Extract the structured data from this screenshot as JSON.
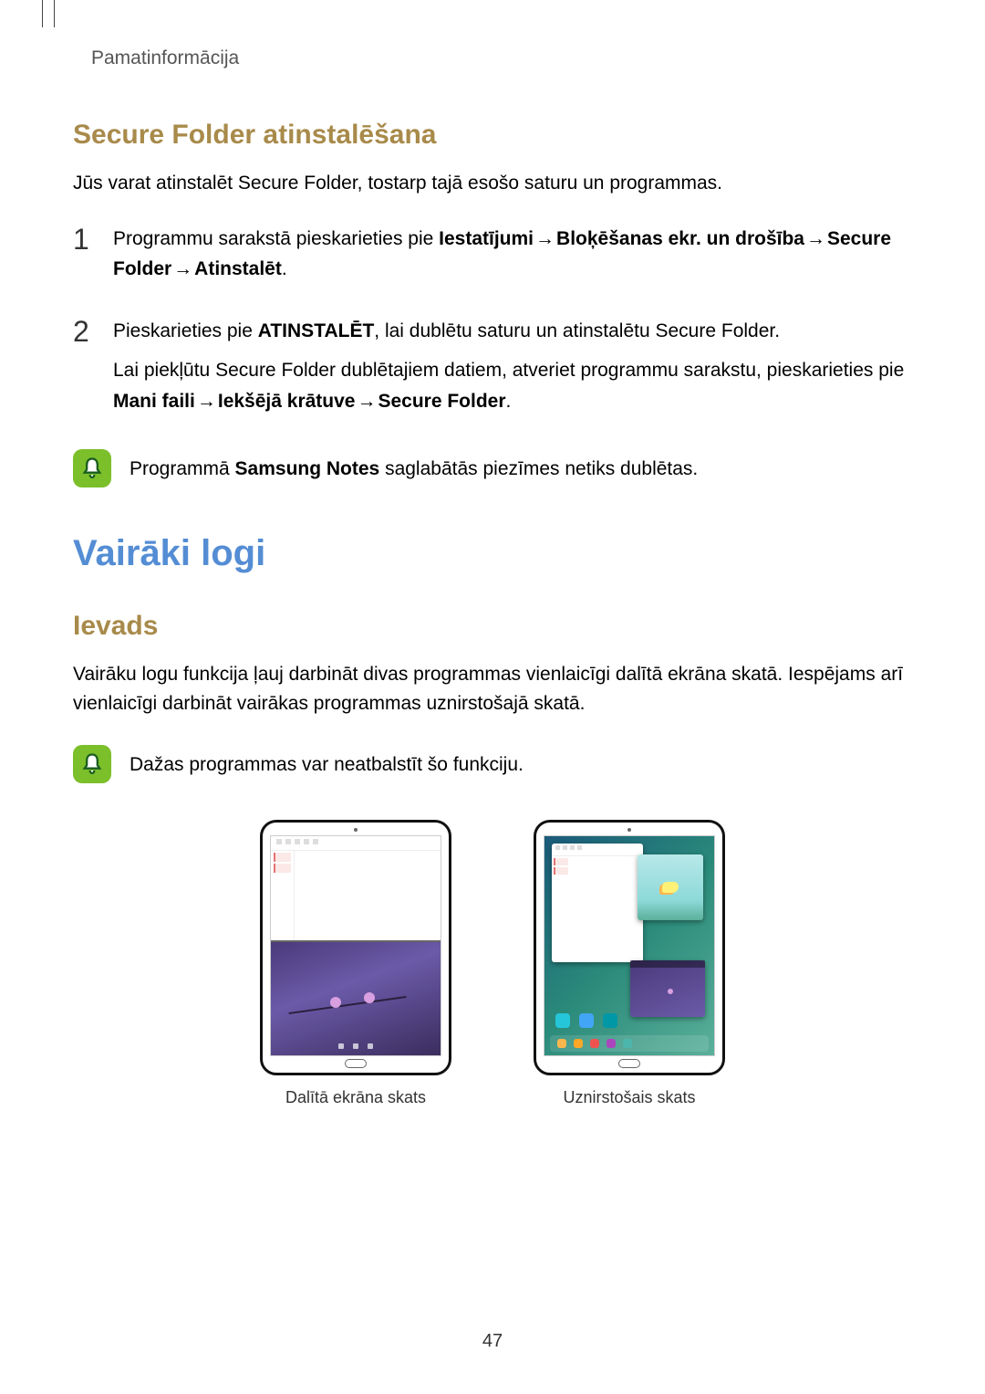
{
  "header": "Pamatinformācija",
  "section1": {
    "heading": "Secure Folder atinstalēšana",
    "intro": "Jūs varat atinstalēt Secure Folder, tostarp tajā esošo saturu un programmas.",
    "step1": {
      "num": "1",
      "pre": "Programmu sarakstā pieskarieties pie ",
      "b1": "Iestatījumi",
      "b2": "Bloķēšanas ekr. un drošība",
      "b3": "Secure Folder",
      "b4": "Atinstalēt",
      "arrow": "→",
      "period": "."
    },
    "step2": {
      "num": "2",
      "l1_pre": "Pieskarieties pie ",
      "l1_b": "ATINSTALĒT",
      "l1_post": ", lai dublētu saturu un atinstalētu Secure Folder.",
      "l2_pre": "Lai piekļūtu Secure Folder dublētajiem datiem, atveriet programmu sarakstu, pieskarieties pie ",
      "l2_b1": "Mani faili",
      "l2_b2": "Iekšējā krātuve",
      "l2_b3": "Secure Folder",
      "period": "."
    },
    "note": {
      "pre": "Programmā ",
      "b": "Samsung Notes",
      "post": " saglabātās piezīmes netiks dublētas."
    }
  },
  "section2": {
    "heading_h1": "Vairāki logi",
    "heading_h2": "Ievads",
    "intro": "Vairāku logu funkcija ļauj darbināt divas programmas vienlaicīgi dalītā ekrāna skatā. Iespējams arī vienlaicīgi darbināt vairākas programmas uznirstošajā skatā.",
    "note": "Dažas programmas var neatbalstīt šo funkciju."
  },
  "figures": {
    "caption1": "Dalītā ekrāna skats",
    "caption2": "Uznirstošais skats"
  },
  "page_number": "47"
}
